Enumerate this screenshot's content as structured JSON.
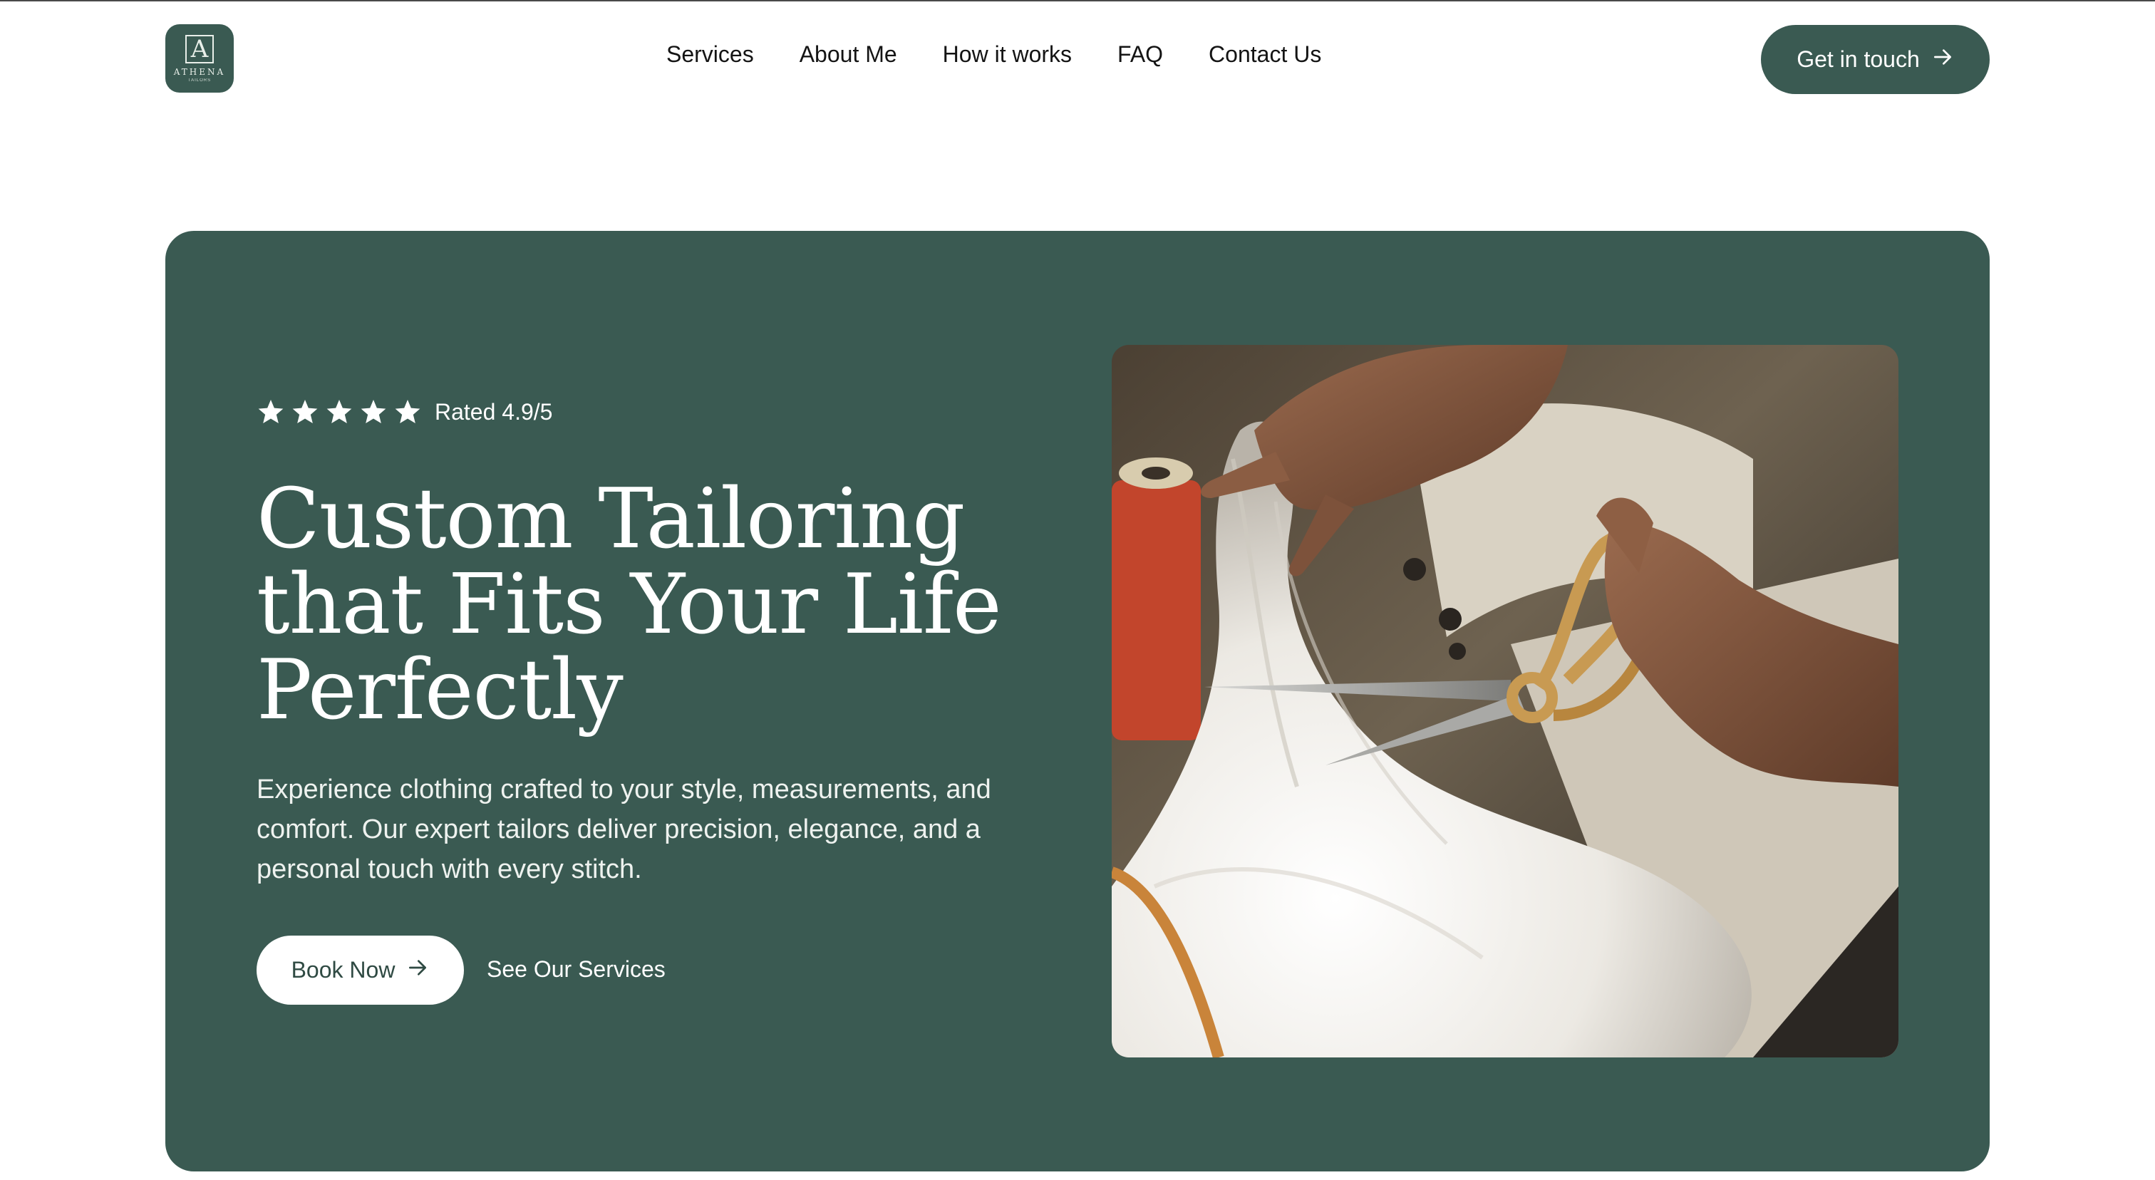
{
  "brand": {
    "name": "ATHENA",
    "tagline": "TAILORS",
    "monogram": "A"
  },
  "nav": {
    "items": [
      "Services",
      "About Me",
      "How it works",
      "FAQ",
      "Contact Us"
    ]
  },
  "header": {
    "cta_label": "Get in touch"
  },
  "hero": {
    "star_count": 5,
    "rating_label": "Rated 4.9/5",
    "headline_lines": [
      "Custom Tailoring",
      "that Fits Your Life",
      "Perfectly"
    ],
    "description": "Experience clothing crafted to your style, measurements, and comfort. Our expert tailors deliver precision, elegance, and a personal touch with every stitch.",
    "primary_button": "Book Now",
    "secondary_link": "See Our Services"
  },
  "colors": {
    "brand_green": "#3a5a52",
    "white": "#ffffff",
    "nav_text": "#141414"
  },
  "icons": [
    "star-icon",
    "arrow-right-icon"
  ]
}
